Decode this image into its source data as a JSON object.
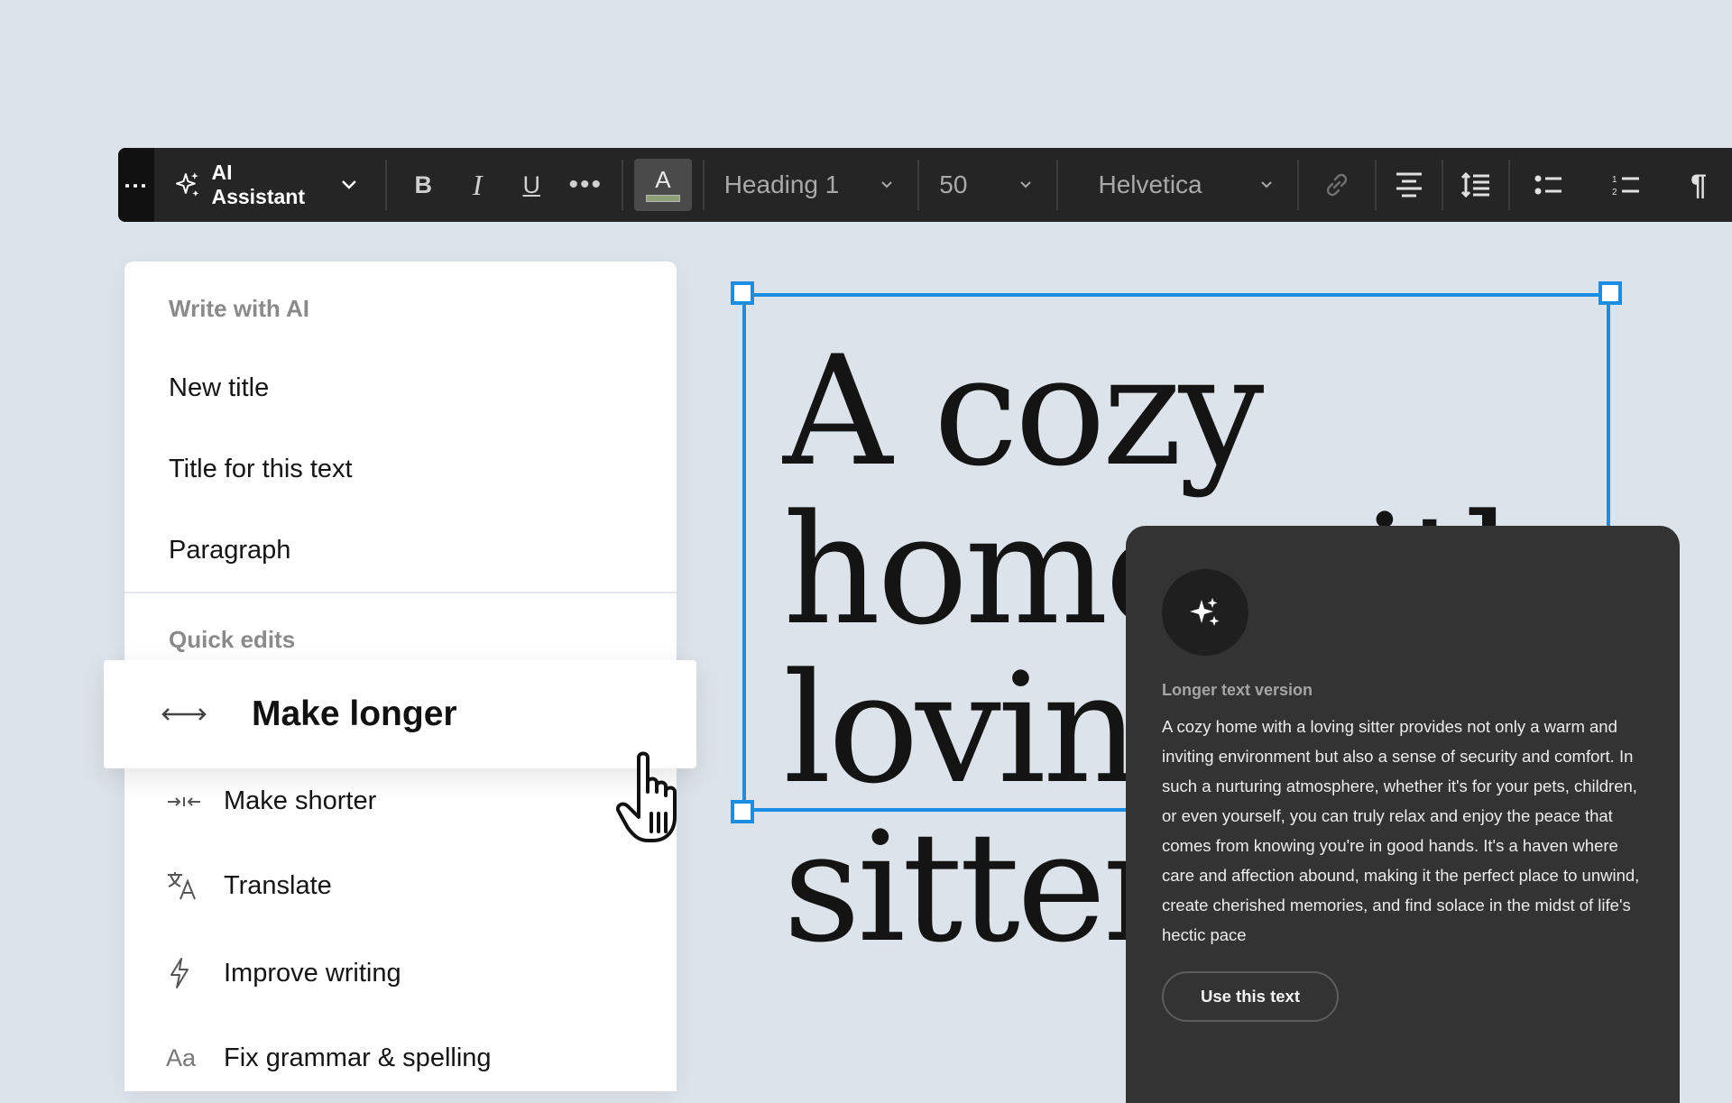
{
  "colors": {
    "accent": "#1b8de2",
    "toolbar_bg": "#252525",
    "panel_bg": "#333333",
    "canvas_bg": "#dde3ea"
  },
  "toolbar": {
    "ai_assistant_label": "AI Assistant",
    "block_type": "Heading 1",
    "font_size": "50",
    "font_family": "Helvetica",
    "icons": [
      "drag-handle-icon",
      "sparkles-icon",
      "chevron-down-icon",
      "bold-icon",
      "italic-icon",
      "underline-icon",
      "more-icon",
      "text-color-icon",
      "link-icon",
      "align-center-icon",
      "line-height-icon",
      "bullet-list-icon",
      "numbered-list-icon",
      "paragraph-icon"
    ]
  },
  "ai_menu": {
    "write_section": "Write with AI",
    "write_items": [
      "New title",
      "Title for this text",
      "Paragraph"
    ],
    "quick_section": "Quick edits",
    "quick_items": [
      {
        "label": "Make longer",
        "icon": "arrows-horizontal-icon"
      },
      {
        "label": "Make shorter",
        "icon": "arrows-inward-icon"
      },
      {
        "label": "Translate",
        "icon": "translate-icon"
      },
      {
        "label": "Improve writing",
        "icon": "lightning-icon"
      },
      {
        "label": "Fix grammar & spelling",
        "icon": "font-icon",
        "icon_text": "Aa"
      }
    ]
  },
  "canvas": {
    "heading_text": "A cozy\nhome with\nloving sitter"
  },
  "result_panel": {
    "label": "Longer text version",
    "body": "A cozy home with a loving sitter provides not only a warm and inviting environment but also a sense of security and comfort. In such a nurturing atmosphere, whether it's for your pets, children, or even yourself, you can truly relax and enjoy the peace that comes from knowing you're in good hands. It's a haven where care and affection abound, making it the perfect place to unwind, create cherished memories, and find solace in the midst of life's hectic pace",
    "use_button": "Use this text"
  }
}
